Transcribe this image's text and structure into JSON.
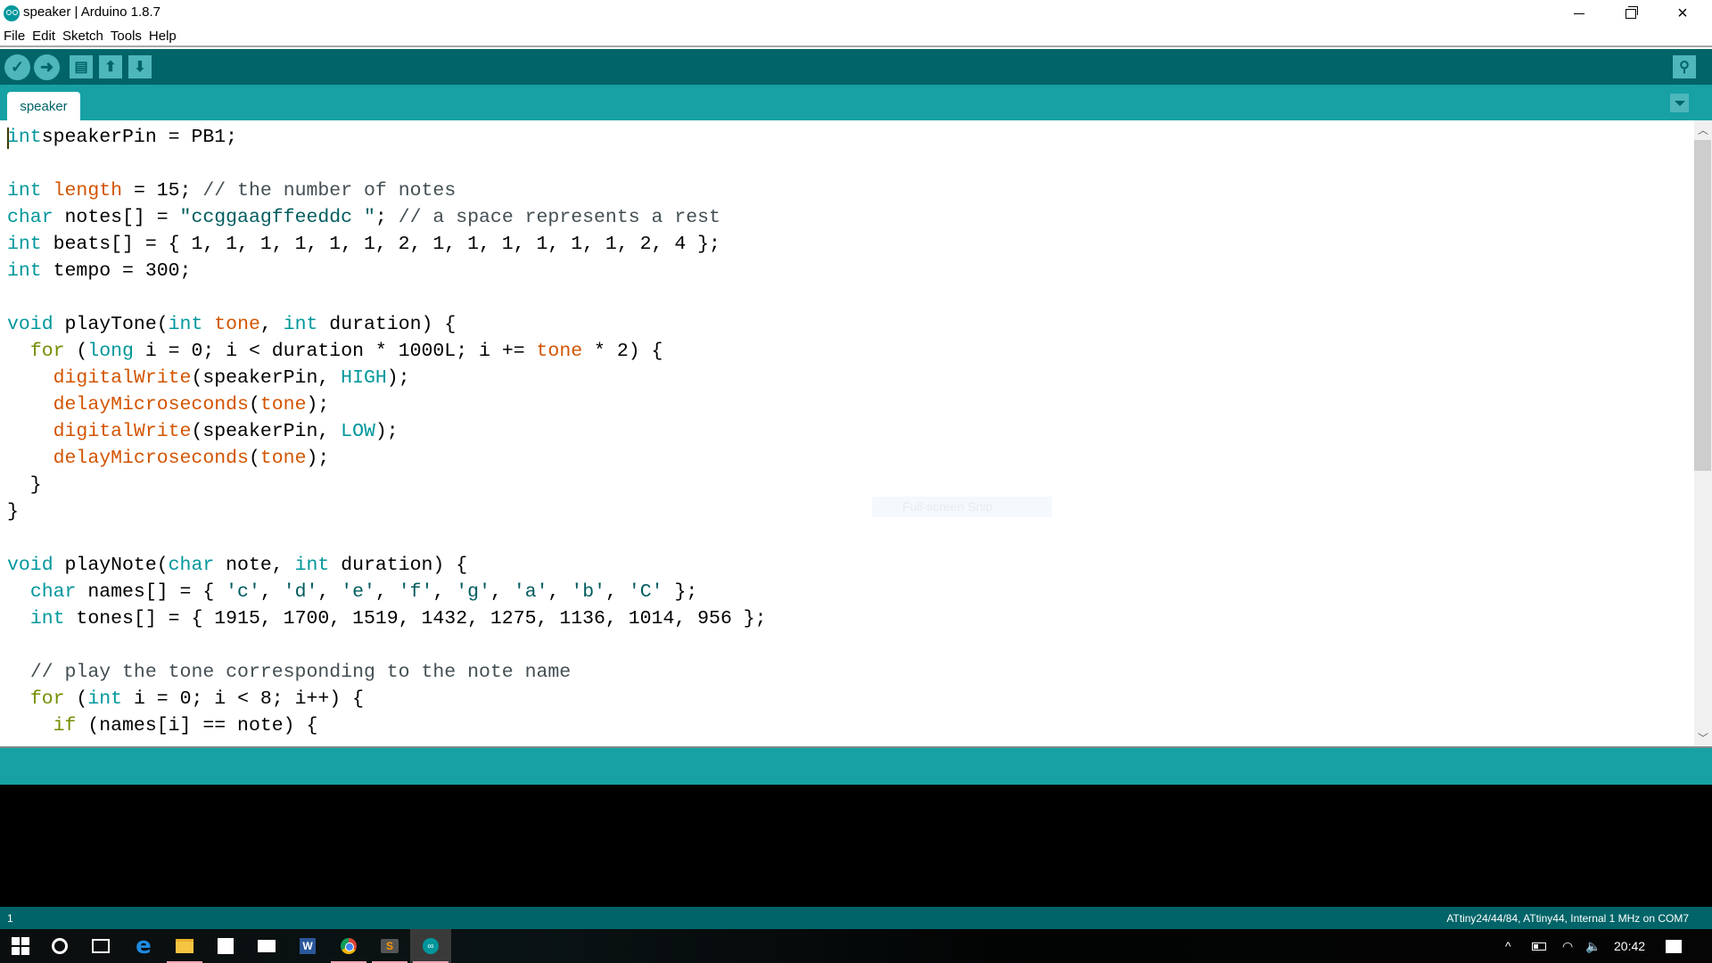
{
  "window": {
    "title": "speaker | Arduino 1.8.7",
    "minimize_label": "minimize",
    "maximize_label": "restore",
    "close_label": "×"
  },
  "menu": {
    "items": [
      "File",
      "Edit",
      "Sketch",
      "Tools",
      "Help"
    ]
  },
  "toolbar": {
    "verify_glyph": "✓",
    "upload_glyph": "➜",
    "new_glyph": "▤",
    "open_glyph": "⬆",
    "save_glyph": "⬇",
    "serial_glyph": "⚲"
  },
  "tabs": [
    {
      "label": "speaker",
      "active": true
    }
  ],
  "editor": {
    "lines": [
      [
        [
          "kw",
          "int"
        ],
        [
          "",
          "speakerPin = PB1;"
        ]
      ],
      [],
      [
        [
          "kw",
          "int"
        ],
        [
          "",
          " "
        ],
        [
          "fn",
          "length"
        ],
        [
          "",
          " = 15; "
        ],
        [
          "cm",
          "// the number of notes"
        ]
      ],
      [
        [
          "kw",
          "char"
        ],
        [
          "",
          " notes[] = "
        ],
        [
          "st",
          "\"ccggaagffeeddc \""
        ],
        [
          "",
          ";"
        ],
        [
          "cm",
          " // a space represents a rest"
        ]
      ],
      [
        [
          "kw",
          "int"
        ],
        [
          "",
          " beats[] = { 1, 1, 1, 1, 1, 1, 2, 1, 1, 1, 1, 1, 1, 2, 4 };"
        ]
      ],
      [
        [
          "kw",
          "int"
        ],
        [
          "",
          " tempo = 300;"
        ]
      ],
      [],
      [
        [
          "kw",
          "void"
        ],
        [
          "",
          " playTone("
        ],
        [
          "kw",
          "int"
        ],
        [
          "",
          " "
        ],
        [
          "fn",
          "tone"
        ],
        [
          "",
          ", "
        ],
        [
          "kw",
          "int"
        ],
        [
          "",
          " duration) {"
        ]
      ],
      [
        [
          "",
          "  "
        ],
        [
          "kw2",
          "for"
        ],
        [
          "",
          " ("
        ],
        [
          "kw",
          "long"
        ],
        [
          "",
          " i = 0; i < duration * 1000L; i += "
        ],
        [
          "fn",
          "tone"
        ],
        [
          "",
          " * 2) {"
        ]
      ],
      [
        [
          "",
          "    "
        ],
        [
          "fn",
          "digitalWrite"
        ],
        [
          "",
          "(speakerPin, "
        ],
        [
          "kw",
          "HIGH"
        ],
        [
          "",
          ");"
        ]
      ],
      [
        [
          "",
          "    "
        ],
        [
          "fn",
          "delayMicroseconds"
        ],
        [
          "",
          "("
        ],
        [
          "fn",
          "tone"
        ],
        [
          "",
          ");"
        ]
      ],
      [
        [
          "",
          "    "
        ],
        [
          "fn",
          "digitalWrite"
        ],
        [
          "",
          "(speakerPin, "
        ],
        [
          "kw",
          "LOW"
        ],
        [
          "",
          ");"
        ]
      ],
      [
        [
          "",
          "    "
        ],
        [
          "fn",
          "delayMicroseconds"
        ],
        [
          "",
          "("
        ],
        [
          "fn",
          "tone"
        ],
        [
          "",
          ");"
        ]
      ],
      [
        [
          "",
          "  }"
        ]
      ],
      [
        [
          "",
          "}"
        ]
      ],
      [],
      [
        [
          "kw",
          "void"
        ],
        [
          "",
          " playNote("
        ],
        [
          "kw",
          "char"
        ],
        [
          "",
          " note, "
        ],
        [
          "kw",
          "int"
        ],
        [
          "",
          " duration) {"
        ]
      ],
      [
        [
          "",
          "  "
        ],
        [
          "kw",
          "char"
        ],
        [
          "",
          " names[] = { "
        ],
        [
          "st",
          "'c'"
        ],
        [
          "",
          ", "
        ],
        [
          "st",
          "'d'"
        ],
        [
          "",
          ", "
        ],
        [
          "st",
          "'e'"
        ],
        [
          "",
          ", "
        ],
        [
          "st",
          "'f'"
        ],
        [
          "",
          ", "
        ],
        [
          "st",
          "'g'"
        ],
        [
          "",
          ", "
        ],
        [
          "st",
          "'a'"
        ],
        [
          "",
          ", "
        ],
        [
          "st",
          "'b'"
        ],
        [
          "",
          ", "
        ],
        [
          "st",
          "'C'"
        ],
        [
          "",
          " };"
        ]
      ],
      [
        [
          "",
          "  "
        ],
        [
          "kw",
          "int"
        ],
        [
          "",
          " tones[] = { 1915, 1700, 1519, 1432, 1275, 1136, 1014, 956 };"
        ]
      ],
      [],
      [
        [
          "",
          "  "
        ],
        [
          "cm",
          "// play the tone corresponding to the note name"
        ]
      ],
      [
        [
          "",
          "  "
        ],
        [
          "kw2",
          "for"
        ],
        [
          "",
          " ("
        ],
        [
          "kw",
          "int"
        ],
        [
          "",
          " i = 0; i < 8; i++) {"
        ]
      ],
      [
        [
          "",
          "    "
        ],
        [
          "kw2",
          "if"
        ],
        [
          "",
          " (names[i] == note) {"
        ]
      ]
    ]
  },
  "overlay": {
    "snip_label": "Full-screen Snip"
  },
  "statusbar": {
    "line_number": "1",
    "board_info": "ATtiny24/44/84, ATtiny44, Internal 1 MHz on COM7"
  },
  "taskbar": {
    "apps": [
      {
        "name": "start",
        "active": false,
        "running": false
      },
      {
        "name": "cortana",
        "active": false,
        "running": false
      },
      {
        "name": "task-view",
        "active": false,
        "running": false
      },
      {
        "name": "edge",
        "active": false,
        "running": false
      },
      {
        "name": "file-explorer",
        "active": false,
        "running": true
      },
      {
        "name": "store",
        "active": false,
        "running": false
      },
      {
        "name": "mail",
        "active": false,
        "running": false
      },
      {
        "name": "word",
        "active": false,
        "running": false
      },
      {
        "name": "chrome",
        "active": false,
        "running": true
      },
      {
        "name": "sublime-text",
        "active": false,
        "running": true
      },
      {
        "name": "arduino",
        "active": true,
        "running": true
      }
    ],
    "word_letter": "W",
    "sublime_letter": "S",
    "arduino_glyph": "∞",
    "tray": {
      "chevron": "^",
      "volume": "🔈",
      "wifi": "◠",
      "clock": "20:42"
    }
  },
  "colors": {
    "teal_dark": "#006468",
    "teal": "#17a1a5",
    "teal_light": "#4db7bb",
    "keyword": "#00979c",
    "control": "#728e00",
    "function": "#d35400",
    "comment": "#434f54",
    "string": "#005c5f"
  }
}
